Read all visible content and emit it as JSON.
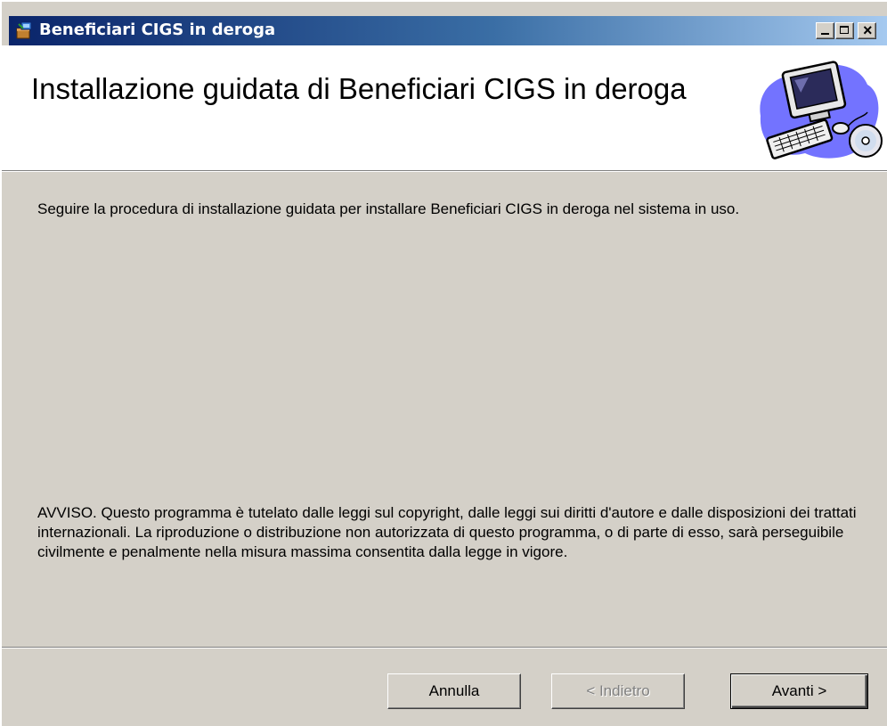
{
  "window": {
    "title": "Beneficiari CIGS in deroga",
    "icon": "installer-package-icon",
    "controls": {
      "minimize_icon": "minimize-icon",
      "maximize_icon": "maximize-icon",
      "close_icon": "close-icon",
      "close_glyph": "×"
    }
  },
  "banner": {
    "title": "Installazione guidata di Beneficiari CIGS in deroga",
    "image": "computer-with-cd-icon"
  },
  "content": {
    "intro": "Seguire la procedura di installazione guidata per installare Beneficiari CIGS in deroga nel sistema in uso.",
    "notice": "AVVISO. Questo programma è tutelato dalle leggi sul copyright, dalle leggi sui diritti d'autore e dalle disposizioni dei trattati internazionali. La riproduzione o distribuzione non autorizzata di questo programma, o di parte di esso, sarà perseguibile civilmente e penalmente nella misura massima consentita dalla legge in vigore."
  },
  "buttons": {
    "cancel": "Annulla",
    "back": "< Indietro",
    "next": "Avanti >"
  },
  "colors": {
    "dialog_bg": "#d4d0c8",
    "titlebar_start": "#0a246a",
    "titlebar_end": "#a6caf0",
    "disabled_text": "#808080"
  }
}
